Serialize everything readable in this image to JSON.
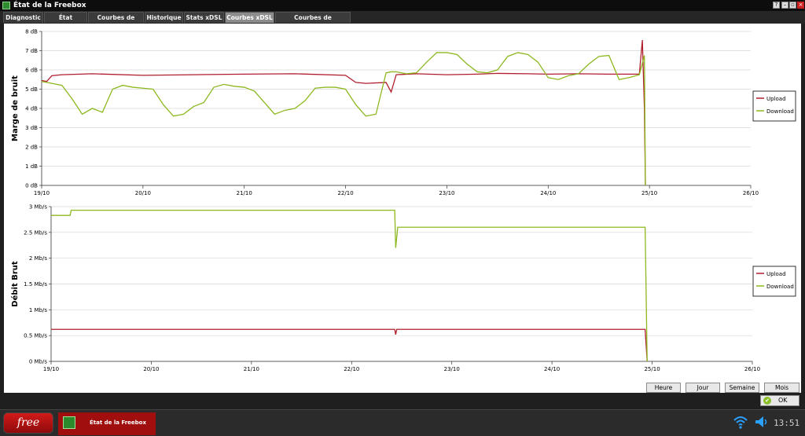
{
  "window": {
    "title": "État de la Freebox"
  },
  "tabs": [
    {
      "label": "Diagnostic",
      "active": false
    },
    {
      "label": "État Internet",
      "active": false
    },
    {
      "label": "Courbes de Débit",
      "active": false
    },
    {
      "label": "Historique",
      "active": false
    },
    {
      "label": "Stats xDSL",
      "active": false
    },
    {
      "label": "Courbes xDSL",
      "active": true
    },
    {
      "label": "Courbes de température",
      "active": false
    }
  ],
  "colors": {
    "upload": "#b01e2e",
    "download": "#8db820"
  },
  "chart_data": [
    {
      "type": "line",
      "ylabel": "Marge de bruit",
      "x_ticks": [
        "19/10",
        "20/10",
        "21/10",
        "22/10",
        "23/10",
        "24/10",
        "25/10",
        "26/10"
      ],
      "y_ticks": [
        "0 dB",
        "1 dB",
        "2 dB",
        "3 dB",
        "4 dB",
        "5 dB",
        "6 dB",
        "7 dB",
        "8 dB"
      ],
      "ylim": [
        0,
        8
      ],
      "xlim": [
        "19/10",
        "26/10"
      ],
      "grid": true,
      "legend": "right",
      "series": [
        {
          "name": "Upload",
          "x": [
            0,
            0.05,
            0.1,
            0.2,
            0.5,
            1.0,
            1.5,
            2.0,
            2.5,
            3.0,
            3.1,
            3.2,
            3.4,
            3.45,
            3.5,
            3.7,
            4.0,
            4.3,
            4.5,
            4.8,
            5.0,
            5.3,
            5.6,
            5.9,
            5.93,
            5.95,
            5.96
          ],
          "y": [
            5.45,
            5.4,
            5.7,
            5.75,
            5.8,
            5.72,
            5.75,
            5.78,
            5.8,
            5.72,
            5.35,
            5.3,
            5.35,
            4.85,
            5.75,
            5.8,
            5.75,
            5.78,
            5.82,
            5.8,
            5.78,
            5.8,
            5.78,
            5.78,
            7.55,
            4.0,
            0
          ]
        },
        {
          "name": "Download",
          "x": [
            0,
            0.1,
            0.2,
            0.3,
            0.4,
            0.5,
            0.6,
            0.7,
            0.8,
            0.9,
            1.0,
            1.1,
            1.2,
            1.3,
            1.4,
            1.5,
            1.6,
            1.7,
            1.8,
            1.9,
            2.0,
            2.1,
            2.2,
            2.3,
            2.4,
            2.5,
            2.6,
            2.7,
            2.8,
            2.9,
            3.0,
            3.1,
            3.2,
            3.3,
            3.4,
            3.45,
            3.5,
            3.6,
            3.7,
            3.8,
            3.9,
            4.0,
            4.1,
            4.2,
            4.3,
            4.4,
            4.5,
            4.6,
            4.7,
            4.8,
            4.9,
            5.0,
            5.1,
            5.2,
            5.3,
            5.4,
            5.5,
            5.6,
            5.7,
            5.8,
            5.9,
            5.95,
            5.96
          ],
          "y": [
            5.4,
            5.3,
            5.2,
            4.5,
            3.7,
            4.0,
            3.8,
            5.0,
            5.2,
            5.1,
            5.05,
            5.0,
            4.2,
            3.6,
            3.7,
            4.1,
            4.3,
            5.1,
            5.25,
            5.15,
            5.1,
            4.9,
            4.3,
            3.7,
            3.9,
            4.0,
            4.4,
            5.05,
            5.1,
            5.1,
            5.0,
            4.2,
            3.6,
            3.7,
            5.85,
            5.9,
            5.9,
            5.8,
            5.85,
            6.4,
            6.9,
            6.9,
            6.8,
            6.3,
            5.9,
            5.85,
            6.0,
            6.7,
            6.9,
            6.8,
            6.4,
            5.6,
            5.5,
            5.7,
            5.8,
            6.3,
            6.7,
            6.75,
            5.5,
            5.6,
            5.75,
            6.75,
            0
          ]
        }
      ]
    },
    {
      "type": "line",
      "ylabel": "Débit Brut",
      "x_ticks": [
        "19/10",
        "20/10",
        "21/10",
        "22/10",
        "23/10",
        "24/10",
        "25/10",
        "26/10"
      ],
      "y_ticks": [
        "0 Mb/s",
        "0.5 Mb/s",
        "1 Mb/s",
        "1.5 Mb/s",
        "2 Mb/s",
        "2.5 Mb/s",
        "3 Mb/s"
      ],
      "ylim": [
        0,
        3
      ],
      "xlim": [
        "19/10",
        "26/10"
      ],
      "grid": true,
      "legend": "right",
      "series": [
        {
          "name": "Upload",
          "x": [
            0,
            3.43,
            3.44,
            3.45,
            3.46,
            5.93,
            5.95
          ],
          "y": [
            0.62,
            0.62,
            0.52,
            0.62,
            0.62,
            0.62,
            0
          ]
        },
        {
          "name": "Download",
          "x": [
            0,
            0.19,
            0.2,
            3.43,
            3.44,
            3.46,
            5.93,
            5.95
          ],
          "y": [
            2.83,
            2.83,
            2.93,
            2.93,
            2.2,
            2.6,
            2.6,
            0
          ]
        }
      ]
    }
  ],
  "buttons": {
    "heure": "Heure",
    "jour": "Jour",
    "semaine": "Semaine",
    "mois": "Mois",
    "ok": "OK"
  },
  "taskbar": {
    "logo": "free",
    "window_label": "État de la Freebox",
    "clock": "13:51"
  }
}
